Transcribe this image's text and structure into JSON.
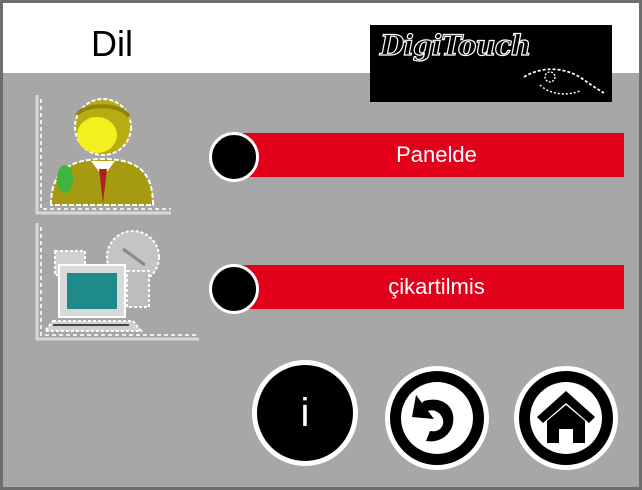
{
  "header": {
    "title": "Dil",
    "logo_text": "DigiTouch"
  },
  "options": [
    {
      "label": "Panelde",
      "icon": "person-at-panel-icon",
      "selected": true
    },
    {
      "label": "çikartilmis",
      "icon": "remote-computer-icon",
      "selected": false
    }
  ],
  "footer": {
    "info_label": "i",
    "back_icon": "back-arrow-icon",
    "home_icon": "home-icon"
  },
  "colors": {
    "background": "#a7a7a7",
    "header": "#ffffff",
    "accent_red": "#e3001b",
    "button_black": "#000000"
  }
}
